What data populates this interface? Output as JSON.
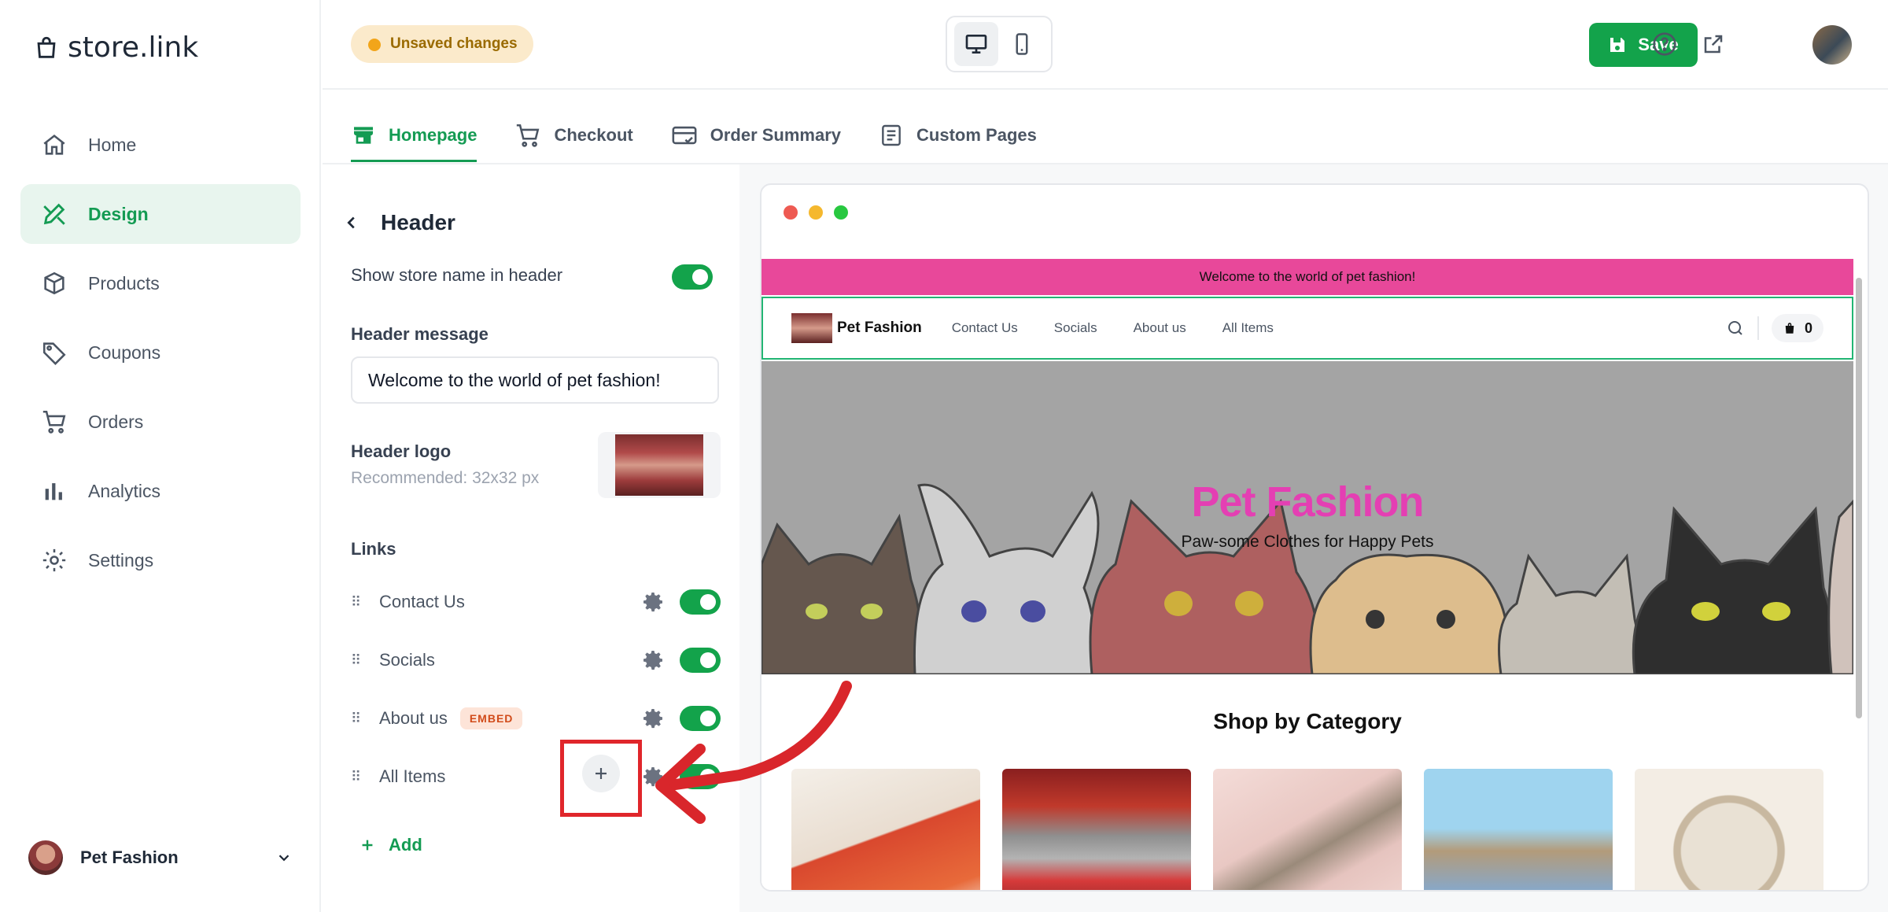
{
  "app": {
    "brand": "store.link"
  },
  "sidebar": {
    "items": [
      {
        "label": "Home",
        "icon": "home-icon",
        "active": false
      },
      {
        "label": "Design",
        "icon": "design-icon",
        "active": true
      },
      {
        "label": "Products",
        "icon": "box-icon",
        "active": false
      },
      {
        "label": "Coupons",
        "icon": "tag-icon",
        "active": false
      },
      {
        "label": "Orders",
        "icon": "cart-icon",
        "active": false
      },
      {
        "label": "Analytics",
        "icon": "bar-chart-icon",
        "active": false
      },
      {
        "label": "Settings",
        "icon": "gear-icon",
        "active": false
      }
    ],
    "store": {
      "name": "Pet Fashion"
    }
  },
  "topbar": {
    "status": "Unsaved changes",
    "save_label": "Save",
    "device": "desktop"
  },
  "tabs": [
    {
      "label": "Homepage",
      "active": true
    },
    {
      "label": "Checkout",
      "active": false
    },
    {
      "label": "Order Summary",
      "active": false
    },
    {
      "label": "Custom Pages",
      "active": false
    }
  ],
  "editor": {
    "title": "Header",
    "show_store_name_label": "Show store name in header",
    "show_store_name": true,
    "header_message_label": "Header message",
    "header_message_value": "Welcome to the world of pet fashion!",
    "header_logo_label": "Header logo",
    "header_logo_hint": "Recommended: 32x32 px",
    "links_label": "Links",
    "links": [
      {
        "label": "Contact Us",
        "badge": "",
        "enabled": true
      },
      {
        "label": "Socials",
        "badge": "",
        "enabled": true
      },
      {
        "label": "About us",
        "badge": "EMBED",
        "enabled": true
      },
      {
        "label": "All Items",
        "badge": "",
        "enabled": true
      }
    ],
    "add_label": "Add"
  },
  "preview": {
    "announcement": "Welcome to the world of pet fashion!",
    "store_name": "Pet Fashion",
    "nav_links": [
      "Contact Us",
      "Socials",
      "About us",
      "All Items"
    ],
    "cart_count": "0",
    "hero_title": "Pet Fashion",
    "hero_subtitle": "Paw-some Clothes for Happy Pets",
    "category_heading": "Shop by Category"
  },
  "colors": {
    "accent": "#13a34b",
    "announcement_bg": "#e8489a",
    "hero_title": "#e43fb3",
    "highlight": "#e0262b"
  }
}
